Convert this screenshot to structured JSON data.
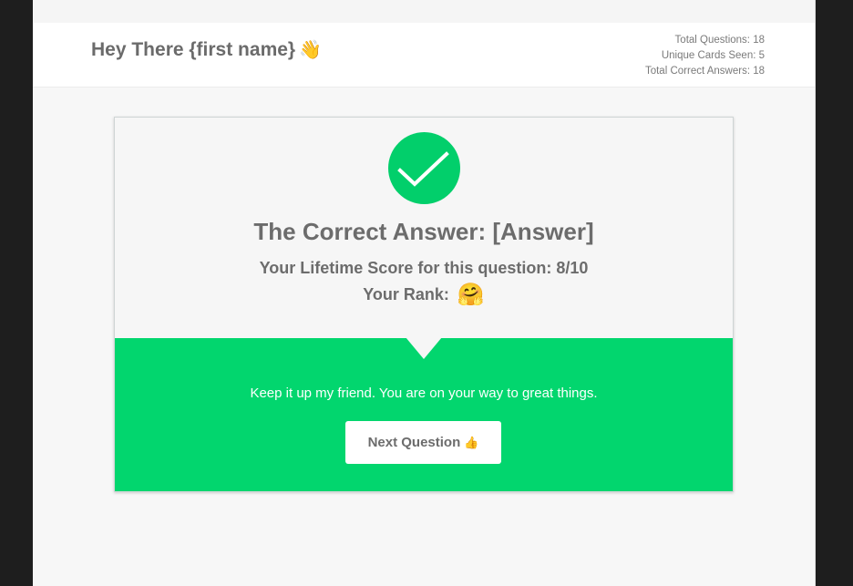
{
  "header": {
    "greeting": "Hey There {first name}",
    "greeting_icon": "waving-hand-icon",
    "stats": {
      "total_questions": "Total Questions: 18",
      "unique_cards": "Unique Cards Seen: 5",
      "total_correct": "Total Correct Answers: 18"
    }
  },
  "result": {
    "status_icon": "checkmark-icon",
    "accent_color": "#02d66e",
    "title": "The Correct Answer: [Answer]",
    "score_line": "Your Lifetime Score for this question: 8/10",
    "rank_label": "Your Rank:",
    "rank_icon": "hugging-face-emoji-icon"
  },
  "feedback": {
    "message": "Keep it up my friend. You are on your way to great things.",
    "next_button_label": "Next Question",
    "next_button_icon": "thumbs-up-icon"
  }
}
